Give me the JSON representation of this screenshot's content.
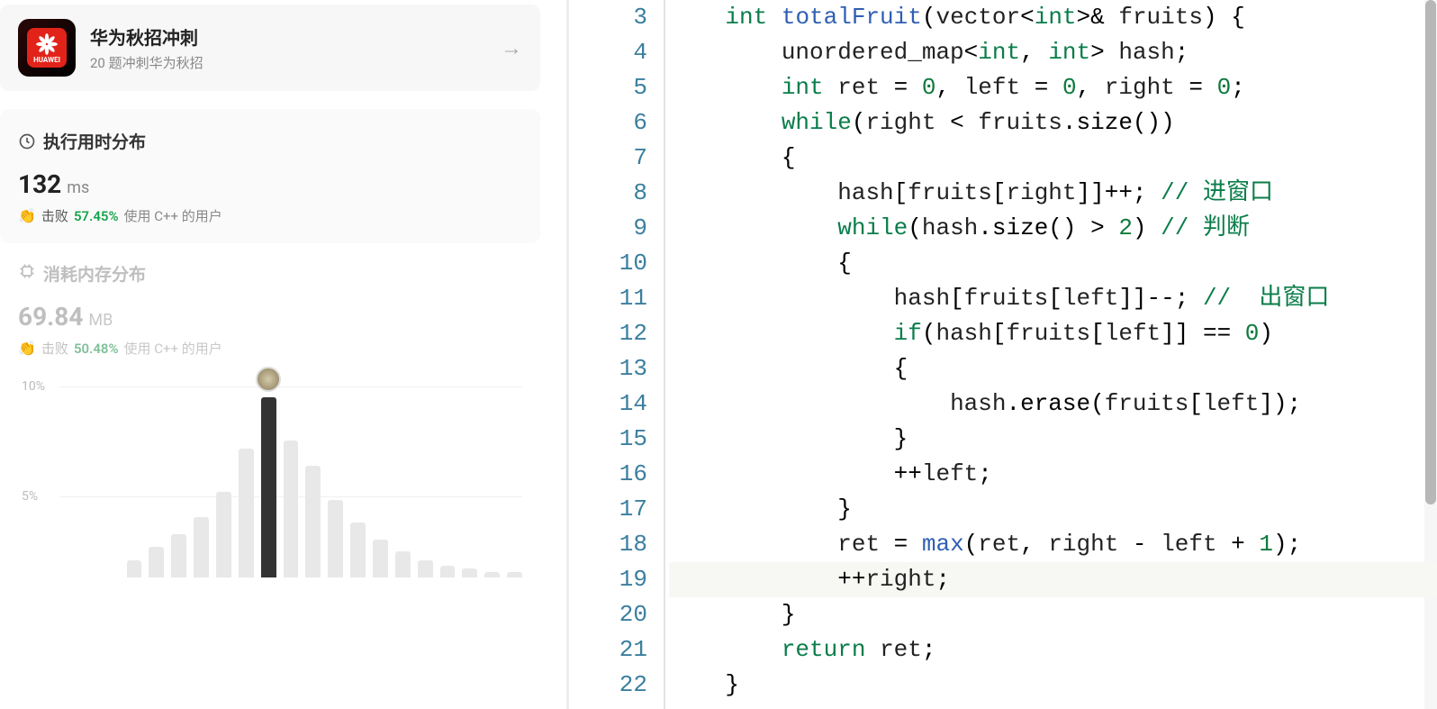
{
  "promo": {
    "title": "华为秋招冲刺",
    "subtitle": "20 题冲刺华为秋招",
    "logo_text": "HUAWEI"
  },
  "runtime": {
    "header": "执行用时分布",
    "value": "132",
    "unit": "ms",
    "beat_label": "击败",
    "percent": "57.45%",
    "suffix": "使用 C++ 的用户"
  },
  "memory": {
    "header": "消耗内存分布",
    "value": "69.84",
    "unit": "MB",
    "beat_label": "击败",
    "percent": "50.48%",
    "suffix": "使用 C++ 的用户"
  },
  "chart_data": {
    "type": "bar",
    "ylabel": "",
    "ylim": [
      0,
      10.5
    ],
    "y_ticks": [
      "5%",
      "10%"
    ],
    "current_index": 9,
    "values": [
      0,
      0,
      0,
      1.0,
      1.8,
      2.5,
      3.5,
      5.0,
      7.5,
      10.5,
      8.0,
      6.5,
      4.5,
      3.2,
      2.2,
      1.5,
      1.0,
      0.7,
      0.5,
      0.3,
      0.3
    ]
  },
  "code": {
    "start_line": 3,
    "highlight_line": 19,
    "lines": [
      {
        "n": 3,
        "seg": [
          {
            "t": "    ",
            "c": ""
          },
          {
            "t": "int",
            "c": "kw"
          },
          {
            "t": " ",
            "c": ""
          },
          {
            "t": "totalFruit",
            "c": "fn"
          },
          {
            "t": "(",
            "c": ""
          },
          {
            "t": "vector",
            "c": "id"
          },
          {
            "t": "<",
            "c": ""
          },
          {
            "t": "int",
            "c": "kw"
          },
          {
            "t": ">& ",
            "c": ""
          },
          {
            "t": "fruits",
            "c": "id"
          },
          {
            "t": ") {",
            "c": ""
          }
        ]
      },
      {
        "n": 4,
        "seg": [
          {
            "t": "        ",
            "c": ""
          },
          {
            "t": "unordered_map",
            "c": "id"
          },
          {
            "t": "<",
            "c": ""
          },
          {
            "t": "int",
            "c": "kw"
          },
          {
            "t": ", ",
            "c": ""
          },
          {
            "t": "int",
            "c": "kw"
          },
          {
            "t": "> ",
            "c": ""
          },
          {
            "t": "hash",
            "c": "id"
          },
          {
            "t": ";",
            "c": ""
          }
        ]
      },
      {
        "n": 5,
        "seg": [
          {
            "t": "        ",
            "c": ""
          },
          {
            "t": "int",
            "c": "kw"
          },
          {
            "t": " ",
            "c": ""
          },
          {
            "t": "ret",
            "c": "id"
          },
          {
            "t": " = ",
            "c": ""
          },
          {
            "t": "0",
            "c": "num"
          },
          {
            "t": ", ",
            "c": ""
          },
          {
            "t": "left",
            "c": "id"
          },
          {
            "t": " = ",
            "c": ""
          },
          {
            "t": "0",
            "c": "num"
          },
          {
            "t": ", ",
            "c": ""
          },
          {
            "t": "right",
            "c": "id"
          },
          {
            "t": " = ",
            "c": ""
          },
          {
            "t": "0",
            "c": "num"
          },
          {
            "t": ";",
            "c": ""
          }
        ]
      },
      {
        "n": 6,
        "seg": [
          {
            "t": "        ",
            "c": ""
          },
          {
            "t": "while",
            "c": "kw"
          },
          {
            "t": "(",
            "c": ""
          },
          {
            "t": "right",
            "c": "id"
          },
          {
            "t": " < ",
            "c": ""
          },
          {
            "t": "fruits",
            "c": "id"
          },
          {
            "t": ".size())",
            "c": ""
          }
        ]
      },
      {
        "n": 7,
        "seg": [
          {
            "t": "        {",
            "c": ""
          }
        ]
      },
      {
        "n": 8,
        "seg": [
          {
            "t": "            ",
            "c": ""
          },
          {
            "t": "hash",
            "c": "id"
          },
          {
            "t": "[",
            "c": ""
          },
          {
            "t": "fruits",
            "c": "id"
          },
          {
            "t": "[",
            "c": ""
          },
          {
            "t": "right",
            "c": "id"
          },
          {
            "t": "]]++; ",
            "c": ""
          },
          {
            "t": "// 进窗口",
            "c": "cm"
          }
        ]
      },
      {
        "n": 9,
        "seg": [
          {
            "t": "            ",
            "c": ""
          },
          {
            "t": "while",
            "c": "kw"
          },
          {
            "t": "(",
            "c": ""
          },
          {
            "t": "hash",
            "c": "id"
          },
          {
            "t": ".size() > ",
            "c": ""
          },
          {
            "t": "2",
            "c": "num"
          },
          {
            "t": ") ",
            "c": ""
          },
          {
            "t": "// 判断",
            "c": "cm"
          }
        ]
      },
      {
        "n": 10,
        "seg": [
          {
            "t": "            {",
            "c": ""
          }
        ]
      },
      {
        "n": 11,
        "seg": [
          {
            "t": "                ",
            "c": ""
          },
          {
            "t": "hash",
            "c": "id"
          },
          {
            "t": "[",
            "c": ""
          },
          {
            "t": "fruits",
            "c": "id"
          },
          {
            "t": "[",
            "c": ""
          },
          {
            "t": "left",
            "c": "id"
          },
          {
            "t": "]]--; ",
            "c": ""
          },
          {
            "t": "//  出窗口",
            "c": "cm"
          }
        ]
      },
      {
        "n": 12,
        "seg": [
          {
            "t": "                ",
            "c": ""
          },
          {
            "t": "if",
            "c": "kw"
          },
          {
            "t": "(",
            "c": ""
          },
          {
            "t": "hash",
            "c": "id"
          },
          {
            "t": "[",
            "c": ""
          },
          {
            "t": "fruits",
            "c": "id"
          },
          {
            "t": "[",
            "c": ""
          },
          {
            "t": "left",
            "c": "id"
          },
          {
            "t": "]] == ",
            "c": ""
          },
          {
            "t": "0",
            "c": "num"
          },
          {
            "t": ")",
            "c": ""
          }
        ]
      },
      {
        "n": 13,
        "seg": [
          {
            "t": "                {",
            "c": ""
          }
        ]
      },
      {
        "n": 14,
        "seg": [
          {
            "t": "                    ",
            "c": ""
          },
          {
            "t": "hash",
            "c": "id"
          },
          {
            "t": ".erase(",
            "c": ""
          },
          {
            "t": "fruits",
            "c": "id"
          },
          {
            "t": "[",
            "c": ""
          },
          {
            "t": "left",
            "c": "id"
          },
          {
            "t": "]);",
            "c": ""
          }
        ]
      },
      {
        "n": 15,
        "seg": [
          {
            "t": "                }",
            "c": ""
          }
        ]
      },
      {
        "n": 16,
        "seg": [
          {
            "t": "                ++",
            "c": ""
          },
          {
            "t": "left",
            "c": "id"
          },
          {
            "t": ";",
            "c": ""
          }
        ]
      },
      {
        "n": 17,
        "seg": [
          {
            "t": "            }",
            "c": ""
          }
        ]
      },
      {
        "n": 18,
        "seg": [
          {
            "t": "            ",
            "c": ""
          },
          {
            "t": "ret",
            "c": "id"
          },
          {
            "t": " = ",
            "c": ""
          },
          {
            "t": "max",
            "c": "fn"
          },
          {
            "t": "(",
            "c": ""
          },
          {
            "t": "ret",
            "c": "id"
          },
          {
            "t": ", ",
            "c": ""
          },
          {
            "t": "right",
            "c": "id"
          },
          {
            "t": " - ",
            "c": ""
          },
          {
            "t": "left",
            "c": "id"
          },
          {
            "t": " + ",
            "c": ""
          },
          {
            "t": "1",
            "c": "num"
          },
          {
            "t": ");",
            "c": ""
          }
        ]
      },
      {
        "n": 19,
        "seg": [
          {
            "t": "            ++",
            "c": ""
          },
          {
            "t": "right",
            "c": "id"
          },
          {
            "t": ";",
            "c": ""
          }
        ]
      },
      {
        "n": 20,
        "seg": [
          {
            "t": "        }",
            "c": ""
          }
        ]
      },
      {
        "n": 21,
        "seg": [
          {
            "t": "        ",
            "c": ""
          },
          {
            "t": "return",
            "c": "kw"
          },
          {
            "t": " ",
            "c": ""
          },
          {
            "t": "ret",
            "c": "id"
          },
          {
            "t": ";",
            "c": ""
          }
        ]
      },
      {
        "n": 22,
        "seg": [
          {
            "t": "    }",
            "c": ""
          }
        ]
      }
    ]
  }
}
